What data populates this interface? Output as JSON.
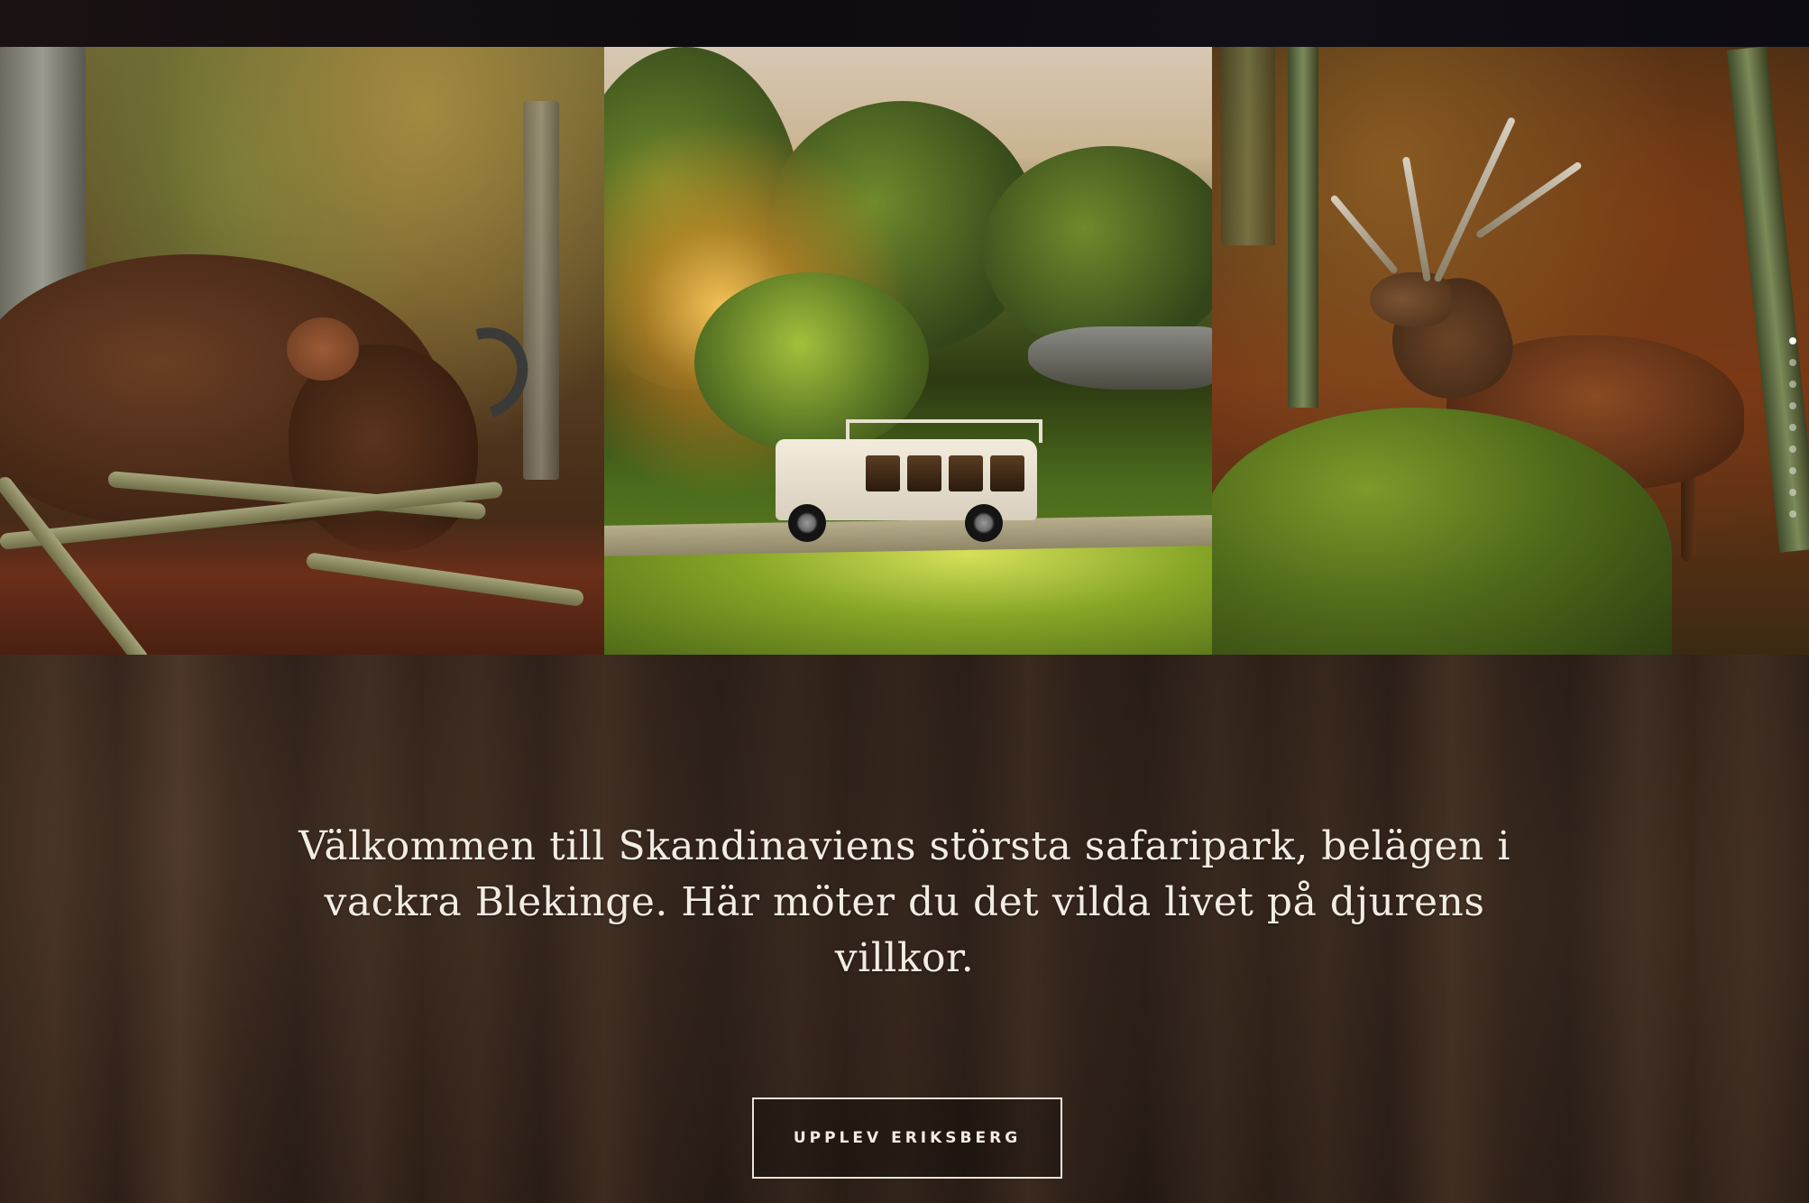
{
  "gallery": {
    "images": [
      {
        "alt": "bison-with-calf"
      },
      {
        "alt": "safari-vehicle-at-sunset"
      },
      {
        "alt": "red-deer-stag"
      }
    ],
    "slider": {
      "dot_count": 9,
      "active_index": 0
    }
  },
  "intro": {
    "text": "Välkommen till Skandinaviens största safaripark, belägen i vackra Blekinge. Här möter du det vilda livet på djurens villkor."
  },
  "cta": {
    "label": "UPPLEV ERIKSBERG"
  },
  "colors": {
    "text": "#f2ece2",
    "button_border": "#e8e2d8",
    "background": "#2a1c14"
  }
}
